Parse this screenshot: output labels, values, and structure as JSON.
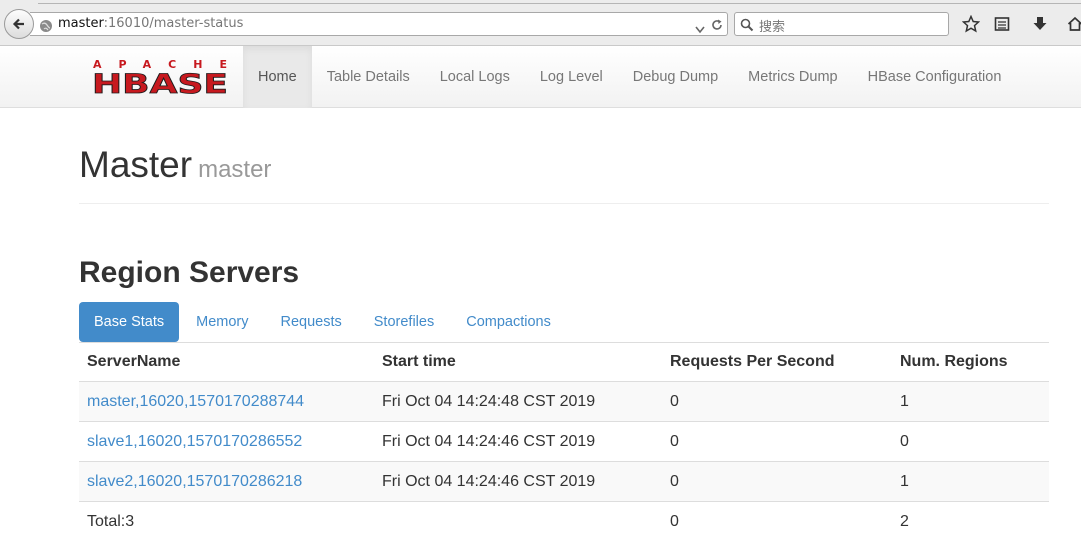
{
  "browser": {
    "url_host": "master",
    "url_rest": ":16010/master-status",
    "search_placeholder": "搜索"
  },
  "navbar": {
    "logo_top": "APACHE",
    "logo_main": "HBASE",
    "items": [
      {
        "label": "Home",
        "active": true
      },
      {
        "label": "Table Details"
      },
      {
        "label": "Local Logs"
      },
      {
        "label": "Log Level"
      },
      {
        "label": "Debug Dump"
      },
      {
        "label": "Metrics Dump"
      },
      {
        "label": "HBase Configuration"
      }
    ]
  },
  "header": {
    "title": "Master",
    "subtitle": "master"
  },
  "region_servers": {
    "title": "Region Servers",
    "tabs": [
      {
        "label": "Base Stats",
        "active": true
      },
      {
        "label": "Memory"
      },
      {
        "label": "Requests"
      },
      {
        "label": "Storefiles"
      },
      {
        "label": "Compactions"
      }
    ],
    "columns": [
      "ServerName",
      "Start time",
      "Requests Per Second",
      "Num. Regions"
    ],
    "rows": [
      {
        "server": "master,16020,1570170288744",
        "start": "Fri Oct 04 14:24:48 CST 2019",
        "rps": "0",
        "regions": "1"
      },
      {
        "server": "slave1,16020,1570170286552",
        "start": "Fri Oct 04 14:24:46 CST 2019",
        "rps": "0",
        "regions": "0"
      },
      {
        "server": "slave2,16020,1570170286218",
        "start": "Fri Oct 04 14:24:46 CST 2019",
        "rps": "0",
        "regions": "1"
      }
    ],
    "total": {
      "label": "Total:3",
      "rps": "0",
      "regions": "2"
    }
  },
  "colors": {
    "accent": "#428bca",
    "logo_red": "#c7191f",
    "logo_dark": "#1c1c1c"
  }
}
